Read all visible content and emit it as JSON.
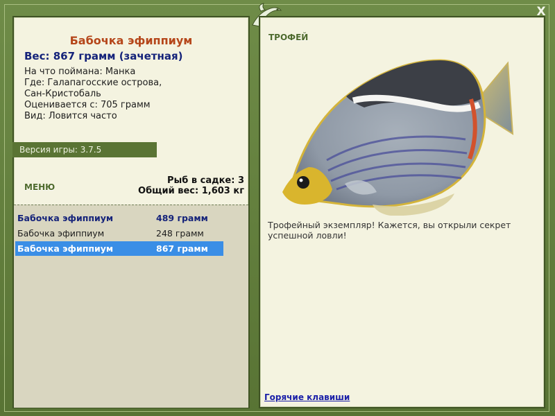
{
  "window": {
    "close_label": "X"
  },
  "fish": {
    "title": "Бабочка эфиппиум",
    "weight_line": "Вес: 867 грамм (зачетная)",
    "info": [
      "На что поймана: Манка",
      "Где: Галапагосские острова,",
      "Сан-Кристобаль",
      "Оценивается с: 705 грамм",
      "Вид: Ловится часто"
    ]
  },
  "version": "Версия игры: 3.7.5",
  "menu_label": "МЕНЮ",
  "stats": {
    "count_line": "Рыб в садке: 3",
    "total_line": "Общий вес: 1,603 кг"
  },
  "list": [
    {
      "name": "Бабочка эфиппиум",
      "weight": "489 грамм"
    },
    {
      "name": "Бабочка эфиппиум",
      "weight": "248 грамм"
    },
    {
      "name": "Бабочка эфиппиум",
      "weight": "867 грамм"
    }
  ],
  "trophy": {
    "label": "ТРОФЕЙ",
    "description": "Трофейный экземпляр! Кажется, вы открыли секрет успешной ловли!"
  },
  "hotkeys_label": "Горячие клавиши"
}
